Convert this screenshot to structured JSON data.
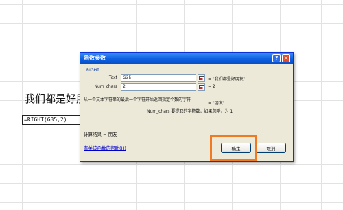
{
  "sheet": {
    "cell_text": "我们都是好朋",
    "formula": "=RIGHT(G35,2)"
  },
  "dialog": {
    "title": "函数参数",
    "help_btn": "?",
    "close_btn": "×",
    "function_name": "RIGHT",
    "args": [
      {
        "label": "Text",
        "value": "G35",
        "result": "= \"我们都是好朋友\""
      },
      {
        "label": "Num_chars",
        "value": "2",
        "result": "= 2"
      }
    ],
    "total_result": "= \"朋友\"",
    "description": "从一个文本字符串的最后一个字符开始返回指定个数的字符",
    "arg_description": "Num_chars  要提取的字符数；如果忽略，为 1",
    "calc_result": "计算结果 =  朋友",
    "help_link": "有关该函数的帮助(H)",
    "ok_label": "确定",
    "cancel_label": "取消"
  },
  "colors": {
    "titlebar": "#0a5ee0",
    "dialog_bg": "#ece9d8",
    "highlight": "#f07a22",
    "link": "#0000cc"
  }
}
